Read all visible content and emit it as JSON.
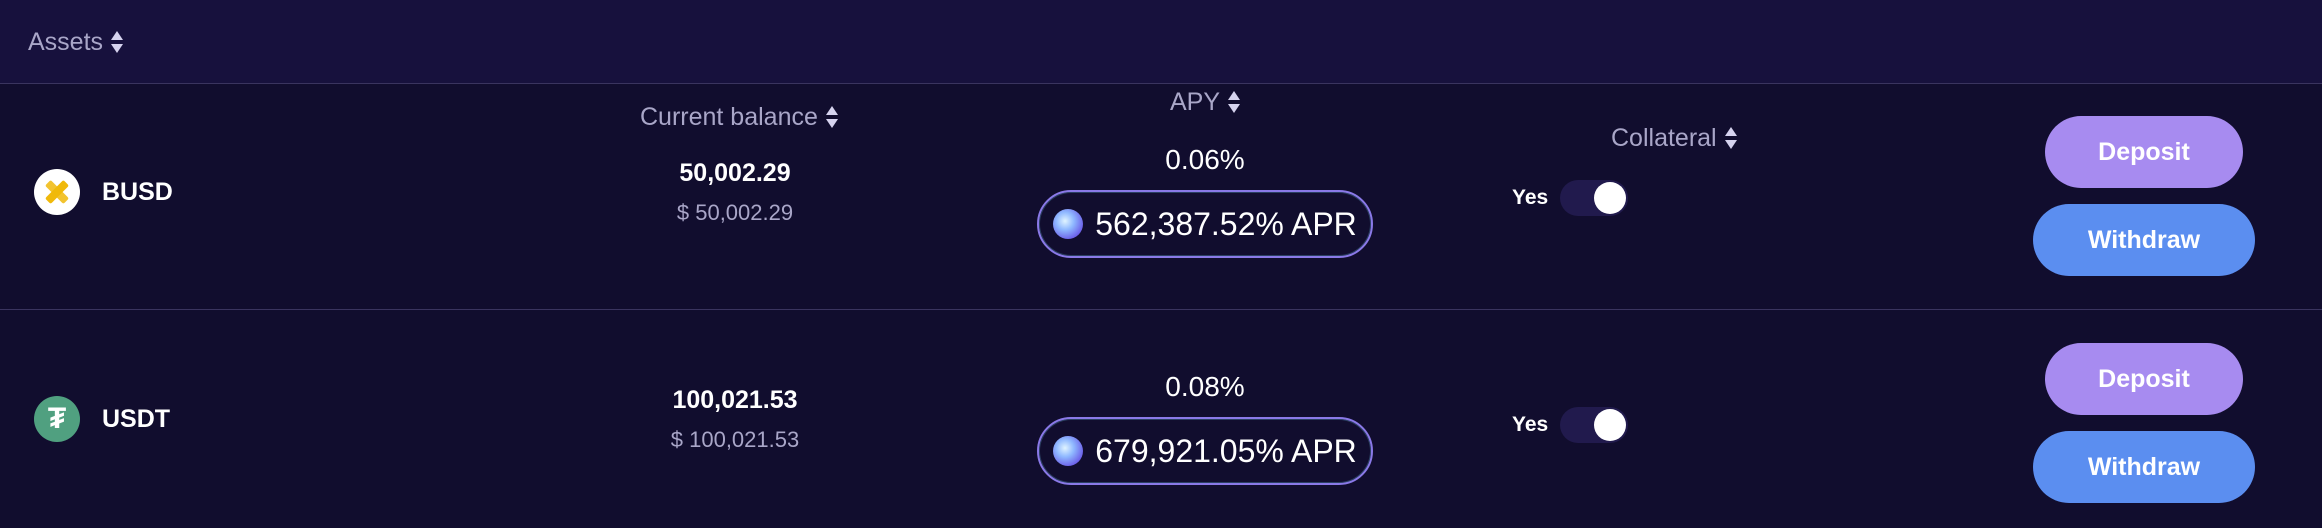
{
  "header": {
    "columns": [
      {
        "label": "Assets"
      },
      {
        "label": "Current balance"
      },
      {
        "label": "APY"
      },
      {
        "label": "Collateral"
      }
    ]
  },
  "rows": [
    {
      "asset": "BUSD",
      "icon": "busd-icon",
      "balance": "50,002.29",
      "balance_usd": "$ 50,002.29",
      "apy": "0.06%",
      "apr": "562,387.52% APR",
      "collateral": "Yes",
      "collateral_enabled": true,
      "deposit_label": "Deposit",
      "withdraw_label": "Withdraw"
    },
    {
      "asset": "USDT",
      "icon": "usdt-icon",
      "balance": "100,021.53",
      "balance_usd": "$ 100,021.53",
      "apy": "0.08%",
      "apr": "679,921.05% APR",
      "collateral": "Yes",
      "collateral_enabled": true,
      "deposit_label": "Deposit",
      "withdraw_label": "Withdraw"
    }
  ],
  "colors": {
    "background": "#110d2e",
    "header_background": "#17113d",
    "deposit_button": "#a78bf0",
    "withdraw_button": "#5b8ef0",
    "apr_border": "#8a79e8",
    "busd_brand": "#f0b90b",
    "usdt_brand": "#50a080"
  }
}
